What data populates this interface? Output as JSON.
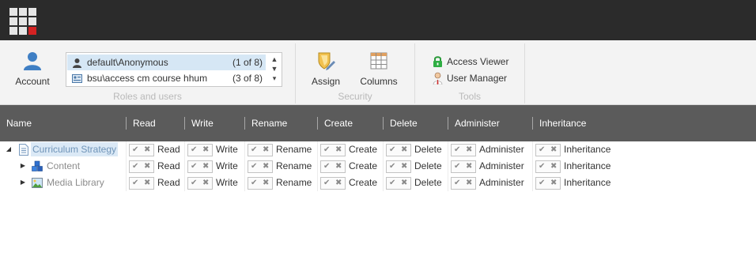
{
  "ribbon": {
    "account_label": "Account",
    "roles": [
      {
        "name": "default\\Anonymous",
        "count": "(1 of 8)",
        "icon": "user-icon",
        "selected": true
      },
      {
        "name": "bsu\\access cm course hhum",
        "count": "(3 of 8)",
        "icon": "role-icon",
        "selected": false
      }
    ],
    "roles_group_label": "Roles and users",
    "assign_label": "Assign",
    "columns_label": "Columns",
    "security_group_label": "Security",
    "access_viewer_label": "Access Viewer",
    "user_manager_label": "User Manager",
    "tools_group_label": "Tools",
    "scroll": {
      "up": "▲",
      "down": "▼",
      "more": "▾"
    }
  },
  "table": {
    "headers": [
      "Name",
      "Read",
      "Write",
      "Rename",
      "Create",
      "Delete",
      "Administer",
      "Inheritance"
    ],
    "glyphs": {
      "allow": "✔",
      "deny": "✖",
      "expanded": "◢",
      "collapsed": "▶"
    },
    "rows": [
      {
        "name": "Curriculum Strategy",
        "icon": "document-icon",
        "expanded": true,
        "selected": true,
        "level": 0,
        "permissions": [
          "Read",
          "Write",
          "Rename",
          "Create",
          "Delete",
          "Administer",
          "Inheritance"
        ]
      },
      {
        "name": "Content",
        "icon": "content-cubes-icon",
        "expanded": false,
        "selected": false,
        "level": 1,
        "permissions": [
          "Read",
          "Write",
          "Rename",
          "Create",
          "Delete",
          "Administer",
          "Inheritance"
        ]
      },
      {
        "name": "Media Library",
        "icon": "image-icon",
        "expanded": false,
        "selected": false,
        "level": 1,
        "permissions": [
          "Read",
          "Write",
          "Rename",
          "Create",
          "Delete",
          "Administer",
          "Inheritance"
        ]
      }
    ]
  },
  "colors": {
    "topbar": "#2b2b2b",
    "ribbon": "#f3f3f3",
    "header_bar": "#5b5b5b",
    "selection": "#d6e7f5",
    "app_grid_accent": "#d42222"
  }
}
